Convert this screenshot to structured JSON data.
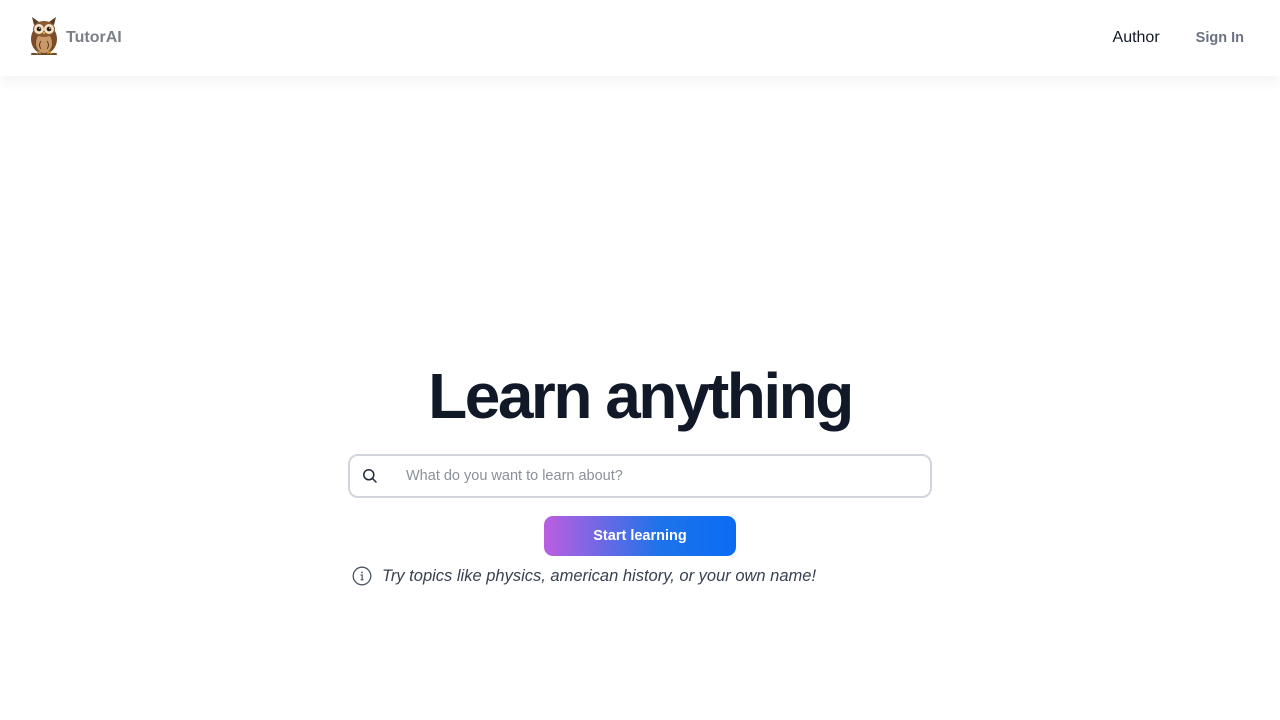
{
  "header": {
    "brand_name": "TutorAI",
    "logo_icon": "owl-icon",
    "nav": {
      "author_label": "Author",
      "signin_label": "Sign In"
    }
  },
  "hero": {
    "title": "Learn anything",
    "search": {
      "placeholder": "What do you want to learn about?",
      "value": "",
      "icon": "search-icon"
    },
    "cta_label": "Start learning",
    "cta_gradient": [
      "#bc5ee0",
      "#0a6cf3"
    ],
    "hint": {
      "icon": "info-icon",
      "text": "Try topics like physics, american history, or your own name!"
    }
  },
  "colors": {
    "title": "#111827",
    "brand": "#7b7f87",
    "muted": "#6b7280"
  }
}
